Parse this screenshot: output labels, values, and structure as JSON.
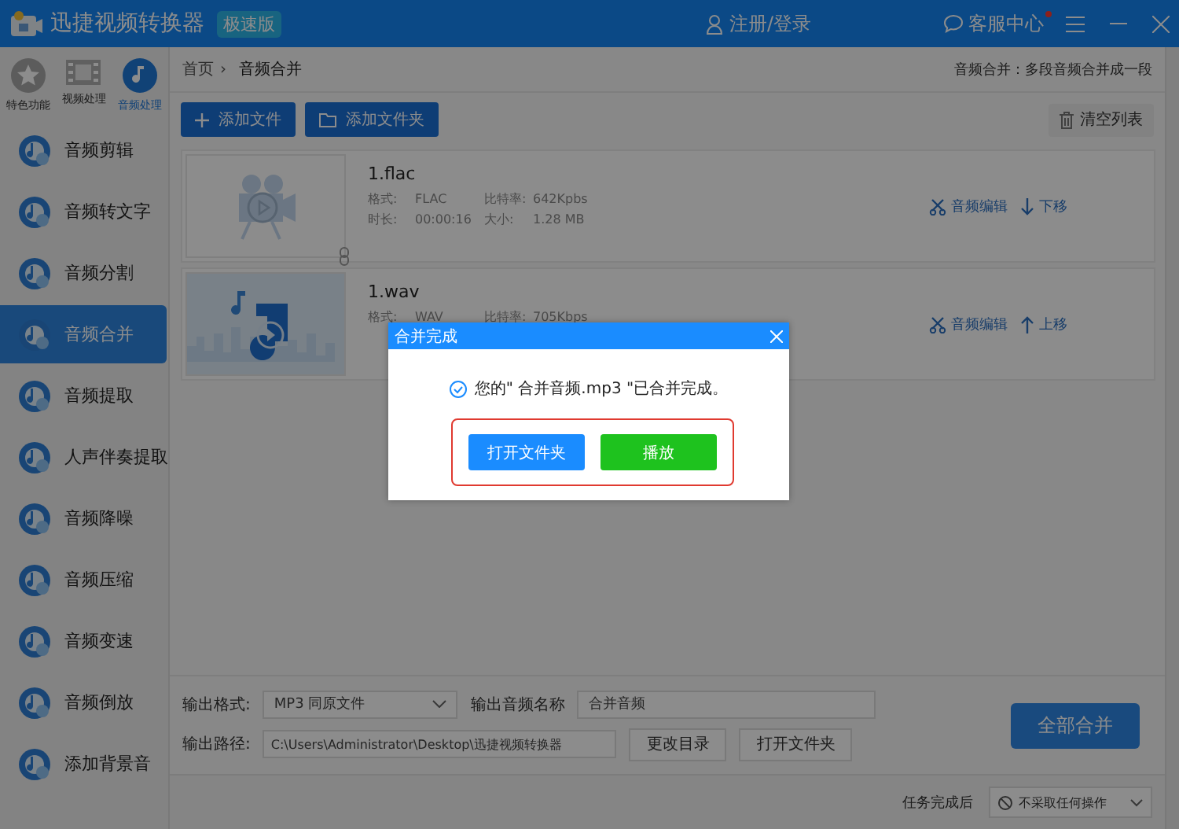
{
  "app": {
    "title": "迅捷视频转换器",
    "edition": "极速版",
    "login": "注册/登录",
    "service": "客服中心",
    "service_badge": true
  },
  "sidebar": {
    "tabs": [
      {
        "label": "特色功能",
        "kind": "star",
        "selected": false
      },
      {
        "label": "视频处理",
        "kind": "film",
        "selected": false
      },
      {
        "label": "音频处理",
        "kind": "note",
        "selected": true
      }
    ],
    "items": [
      {
        "label": "音频剪辑",
        "selected": false
      },
      {
        "label": "音频转文字",
        "selected": false
      },
      {
        "label": "音频分割",
        "selected": false
      },
      {
        "label": "音频合并",
        "selected": true
      },
      {
        "label": "音频提取",
        "selected": false
      },
      {
        "label": "人声伴奏提取",
        "selected": false
      },
      {
        "label": "音频降噪",
        "selected": false
      },
      {
        "label": "音频压缩",
        "selected": false
      },
      {
        "label": "音频变速",
        "selected": false
      },
      {
        "label": "音频倒放",
        "selected": false
      },
      {
        "label": "添加背景音",
        "selected": false
      }
    ]
  },
  "breadcrumb": {
    "home": "首页",
    "separator": "›",
    "current": "音频合并",
    "description": "音频合并：多段音频合并成一段"
  },
  "toolbar": {
    "add_file": "添加文件",
    "add_folder": "添加文件夹",
    "clear": "清空列表"
  },
  "files": [
    {
      "name": "1.flac",
      "kind": "video",
      "fields": [
        {
          "label": "格式:",
          "value": "FLAC"
        },
        {
          "label": "比特率:",
          "value": "642Kpbs"
        },
        {
          "label": "时长:",
          "value": "00:00:16"
        },
        {
          "label": "大小:",
          "value": "1.28 MB"
        }
      ],
      "actions": [
        {
          "kind": "edit",
          "label": "音频编辑"
        },
        {
          "kind": "down",
          "label": "下移"
        }
      ]
    },
    {
      "name": "1.wav",
      "kind": "audio",
      "fields": [
        {
          "label": "格式:",
          "value": "WAV"
        },
        {
          "label": "比特率:",
          "value": "705Kbps"
        }
      ],
      "actions": [
        {
          "kind": "edit",
          "label": "音频编辑"
        },
        {
          "kind": "up",
          "label": "上移"
        }
      ]
    }
  ],
  "output": {
    "format_label": "输出格式:",
    "format": "MP3  同原文件",
    "name_label": "输出音频名称",
    "name": "合并音频",
    "path_label": "输出路径:",
    "path": "C:\\Users\\Administrator\\Desktop\\迅捷视频转换器",
    "change_dir": "更改目录",
    "open_folder": "打开文件夹",
    "merge_all": "全部合并"
  },
  "footer": {
    "label": "任务完成后",
    "option": "不采取任何操作"
  },
  "dialog": {
    "title": "合并完成",
    "message": "您的\" 合并音频.mp3 \"已合并完成。",
    "buttons": [
      {
        "kind": "primary",
        "label": "打开文件夹"
      },
      {
        "kind": "success",
        "label": "播放"
      }
    ]
  }
}
